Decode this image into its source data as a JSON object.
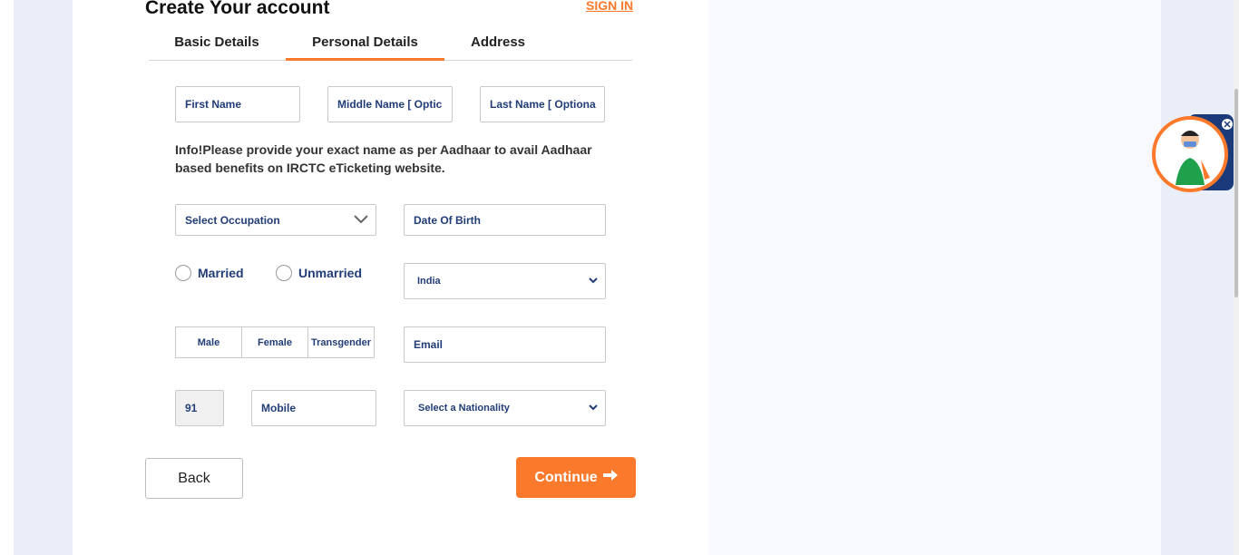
{
  "header": {
    "title": "Create Your account",
    "sign_in": "SIGN IN"
  },
  "tabs": [
    {
      "label": "Basic Details",
      "active": false
    },
    {
      "label": "Personal Details",
      "active": true
    },
    {
      "label": "Address",
      "active": false
    }
  ],
  "form": {
    "first_name": {
      "placeholder": "First Name"
    },
    "middle_name": {
      "placeholder": "Middle Name  [ Optic"
    },
    "last_name": {
      "placeholder": "Last Name  [ Optiona"
    },
    "info": "Info!Please provide your exact name as per Aadhaar to avail Aadhaar based benefits on IRCTC eTicketing website.",
    "occupation": {
      "value": "Select Occupation"
    },
    "dob": {
      "placeholder": "Date Of Birth"
    },
    "marital": {
      "married": "Married",
      "unmarried": "Unmarried"
    },
    "country": {
      "value": "India"
    },
    "gender": [
      "Male",
      "Female",
      "Transgender"
    ],
    "email": {
      "placeholder": "Email"
    },
    "isd": {
      "value": "91"
    },
    "mobile": {
      "placeholder": "Mobile"
    },
    "nationality": {
      "value": "Select a Nationality"
    }
  },
  "buttons": {
    "back": "Back",
    "continue": "Continue"
  },
  "colors": {
    "accent": "#fb792b",
    "label_blue": "#213d77",
    "panel_bg": "#f7f9fd",
    "side_bg": "#e9eef8"
  },
  "icons": {
    "arrow": "arrow-right-icon",
    "chevron": "chevron-down-icon",
    "close": "close-icon",
    "assistant": "assistant-avatar-icon"
  }
}
